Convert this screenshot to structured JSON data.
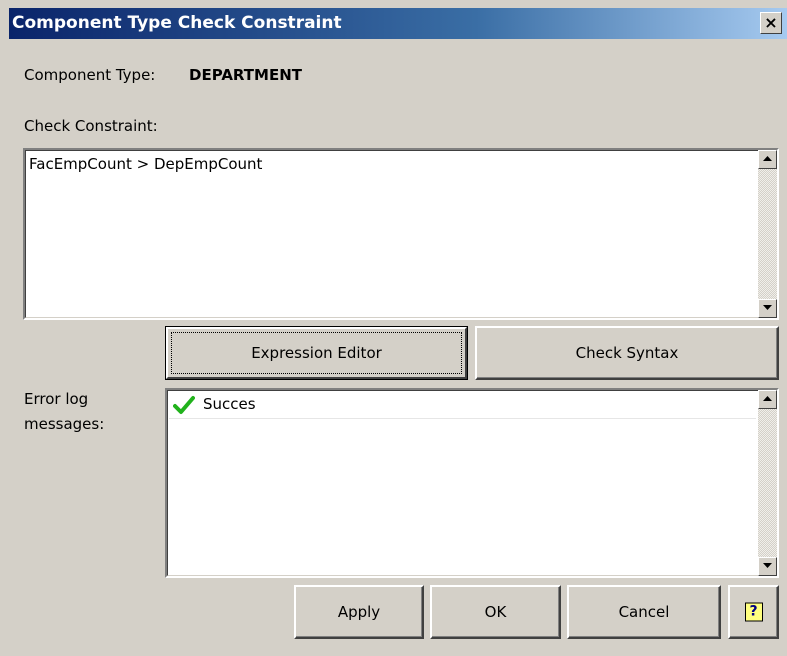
{
  "window": {
    "title": "Component Type Check Constraint",
    "close_glyph": "×"
  },
  "component_type": {
    "label": "Component Type:",
    "value": "DEPARTMENT"
  },
  "check_constraint": {
    "label": "Check Constraint:",
    "value": "FacEmpCount > DepEmpCount"
  },
  "buttons": {
    "expression_editor": "Expression Editor",
    "check_syntax": "Check Syntax",
    "apply": "Apply",
    "ok": "OK",
    "cancel": "Cancel",
    "help_glyph": "?"
  },
  "error_log": {
    "label_line1": "Error log",
    "label_line2": "messages:",
    "entries": [
      {
        "icon": "checkmark-icon",
        "text": "Succes"
      }
    ]
  },
  "colors": {
    "dialog_bg": "#d4d0c8",
    "title_gradient_start": "#0a246a",
    "title_gradient_end": "#a6caf0",
    "success_green": "#21b21c"
  }
}
